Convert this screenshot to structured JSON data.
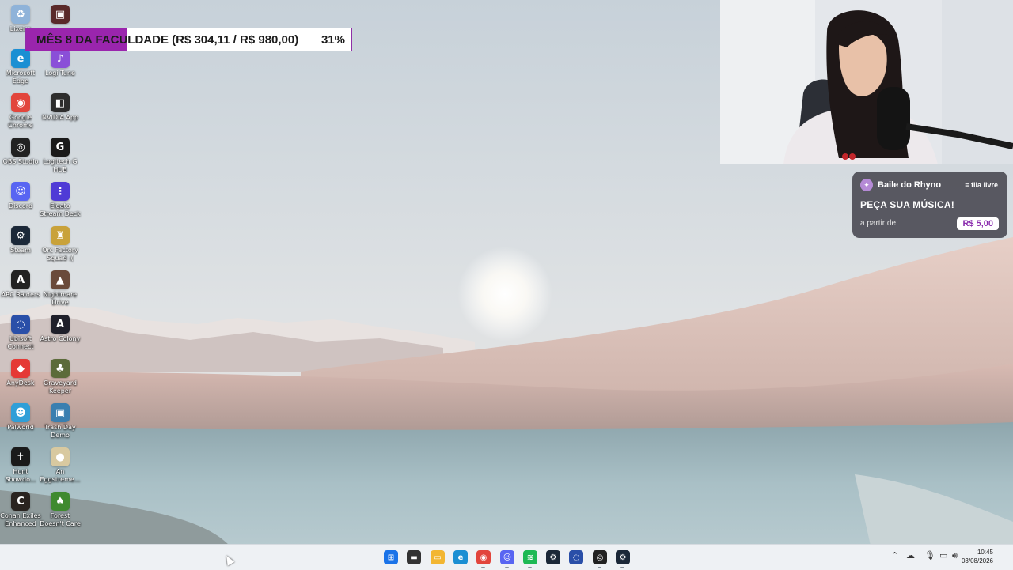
{
  "goal_banner": {
    "text": "MÊS 8 DA FACULDADE (R$ 304,11 / R$ 980,00)",
    "percent_label": "31%",
    "progress": 0.31,
    "fill_color": "#9a25ad"
  },
  "desktop_icons": [
    {
      "label": "Lixeira",
      "icon": "recycle-bin-icon",
      "color": "#8fb3d9",
      "glyph": "♻"
    },
    {
      "label": "",
      "icon": "game-icon",
      "color": "#5a2a2a",
      "glyph": "▣"
    },
    {
      "label": "Microsoft Edge",
      "icon": "edge-icon",
      "color": "#1b8fd3",
      "glyph": "e"
    },
    {
      "label": "Logi Tune",
      "icon": "logi-tune-icon",
      "color": "#8a4fd8",
      "glyph": "♪"
    },
    {
      "label": "Google Chrome",
      "icon": "chrome-icon",
      "color": "#e2453c",
      "glyph": "◉"
    },
    {
      "label": "NVIDIA App",
      "icon": "nvidia-icon",
      "color": "#2d2d2d",
      "glyph": "◧"
    },
    {
      "label": "OBS Studio",
      "icon": "obs-icon",
      "color": "#222222",
      "glyph": "◎"
    },
    {
      "label": "Logitech G HUB",
      "icon": "logitech-g-hub-icon",
      "color": "#1a1a1a",
      "glyph": "G"
    },
    {
      "label": "Discord",
      "icon": "discord-icon",
      "color": "#5865f2",
      "glyph": "☺"
    },
    {
      "label": "Elgato Stream Deck",
      "icon": "stream-deck-icon",
      "color": "#4f3bd6",
      "glyph": "⋮"
    },
    {
      "label": "Steam",
      "icon": "steam-icon",
      "color": "#1b2838",
      "glyph": "⚙"
    },
    {
      "label": "Orc Factory Squad :(",
      "icon": "game-icon",
      "color": "#c9a23a",
      "glyph": "♜"
    },
    {
      "label": "ARC Raiders",
      "icon": "arc-raiders-icon",
      "color": "#222222",
      "glyph": "A"
    },
    {
      "label": "Nightmare Drive",
      "icon": "game-icon",
      "color": "#6a4a3a",
      "glyph": "▲"
    },
    {
      "label": "Ubisoft Connect",
      "icon": "ubisoft-icon",
      "color": "#2a4fa8",
      "glyph": "◌"
    },
    {
      "label": "Astro Colony",
      "icon": "game-icon",
      "color": "#1f1f2a",
      "glyph": "A"
    },
    {
      "label": "AnyDesk",
      "icon": "anydesk-icon",
      "color": "#e53935",
      "glyph": "◆"
    },
    {
      "label": "Graveyard Keeper",
      "icon": "game-icon",
      "color": "#5c6b3a",
      "glyph": "♣"
    },
    {
      "label": "Palworld",
      "icon": "palworld-icon",
      "color": "#2f9fd8",
      "glyph": "☻"
    },
    {
      "label": "Trash Day Demo",
      "icon": "game-icon",
      "color": "#3a7fb0",
      "glyph": "▣"
    },
    {
      "label": "Hunt Showdo...",
      "icon": "game-icon",
      "color": "#1a1a1a",
      "glyph": "✝"
    },
    {
      "label": "An Eggstreme...",
      "icon": "game-icon",
      "color": "#d8c9a0",
      "glyph": "●"
    },
    {
      "label": "Conan Exiles Enhanced",
      "icon": "game-icon",
      "color": "#2a2420",
      "glyph": "C"
    },
    {
      "label": "Forest Doesn't Care",
      "icon": "game-icon",
      "color": "#3f8a2f",
      "glyph": "♠"
    }
  ],
  "song_widget": {
    "streamer": "Baile do Rhyno",
    "queue_label": "fila livre",
    "title": "PEÇA SUA MÚSICA!",
    "from_label": "a partir de",
    "price": "R$ 5,00"
  },
  "taskbar": {
    "apps": [
      {
        "icon": "windows-start-icon",
        "color": "#1a73e8",
        "glyph": "⊞",
        "running": false
      },
      {
        "icon": "terminal-icon",
        "color": "#333333",
        "glyph": "▬",
        "running": false
      },
      {
        "icon": "file-explorer-icon",
        "color": "#f2b632",
        "glyph": "▭",
        "running": false
      },
      {
        "icon": "edge-icon",
        "color": "#1b8fd3",
        "glyph": "e",
        "running": false
      },
      {
        "icon": "chrome-icon",
        "color": "#e2453c",
        "glyph": "◉",
        "running": true
      },
      {
        "icon": "discord-icon",
        "color": "#5865f2",
        "glyph": "☺",
        "running": true
      },
      {
        "icon": "spotify-icon",
        "color": "#1db954",
        "glyph": "≋",
        "running": true
      },
      {
        "icon": "steam-icon",
        "color": "#1b2838",
        "glyph": "⚙",
        "running": false
      },
      {
        "icon": "ubisoft-icon",
        "color": "#2a4fa8",
        "glyph": "◌",
        "running": false
      },
      {
        "icon": "obs-icon",
        "color": "#222222",
        "glyph": "◎",
        "running": true
      },
      {
        "icon": "steam-icon",
        "color": "#1b2838",
        "glyph": "⚙",
        "running": true
      }
    ],
    "tray_icons": [
      "chevron-up-icon",
      "cloud-icon",
      "microphone-icon",
      "display-icon",
      "volume-icon"
    ],
    "time": "10:45",
    "date": "03/08/2026"
  }
}
